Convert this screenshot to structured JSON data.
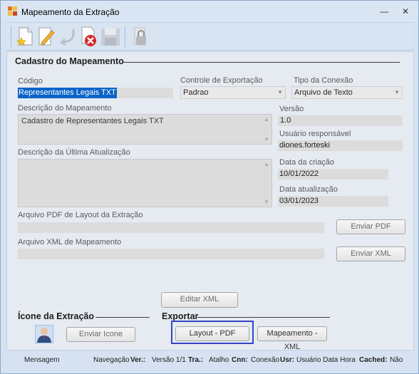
{
  "window": {
    "title": "Mapeamento da Extração",
    "minimize_glyph": "—",
    "close_glyph": "✕"
  },
  "toolbar": {
    "buttons": [
      {
        "icon": "new-document-icon"
      },
      {
        "icon": "edit-pencil-icon"
      },
      {
        "icon": "undo-arrow-icon"
      },
      {
        "icon": "delete-icon"
      },
      {
        "icon": "save-disk-icon"
      },
      {
        "icon": "lock-icon"
      }
    ]
  },
  "form": {
    "group_title": "Cadastro do Mapeamento",
    "codigo_label": "Código",
    "codigo_value": "Representantes Legais TXT",
    "controle_label": "Controle de Exportação",
    "controle_value": "Padrao",
    "tipo_label": "Tipo da Conexão",
    "tipo_value": "Arquivo de Texto",
    "descricao_label": "Descrição do Mapeamento",
    "descricao_value": "Cadastro de Representantes Legais TXT",
    "versao_label": "Versão",
    "versao_value": "1.0",
    "usuario_label": "Usuário responsável",
    "usuario_value": "diones.forteski",
    "ultima_label": "Descrição da Última Atualização",
    "ultima_value": "",
    "data_criacao_label": "Data da criação",
    "data_criacao_value": "10/01/2022",
    "data_atualizacao_label": "Data atualização",
    "data_atualizacao_value": "03/01/2023",
    "pdf_label": "Arquivo PDF de Layout da Extração",
    "pdf_value": "",
    "enviar_pdf": "Enviar PDF",
    "xml_label": "Arquivo XML de Mapeamento",
    "xml_value": "",
    "enviar_xml": "Enviar XML",
    "editar_xml": "Editar XML"
  },
  "icone": {
    "title": "Ícone da Extração",
    "enviar_icone": "Enviar Icone"
  },
  "exportar": {
    "title": "Exportar",
    "layout_pdf": "Layout - PDF",
    "mapeamento_xml": "Mapeamento - XML"
  },
  "statusbar": {
    "mensagem": "Mensagem",
    "navegacao": "Navegação",
    "ver_label": "Ver.:",
    "ver_value": "Versão 1/1",
    "tra_label": "Tra.:",
    "tra_value": "Atalho",
    "cnn_label": "Cnn:",
    "cnn_value": "Conexão",
    "usr_label": "Usr:",
    "usr_value": "Usuário Data Hora",
    "cached_label": "Cached:",
    "cached_value": "Não"
  }
}
